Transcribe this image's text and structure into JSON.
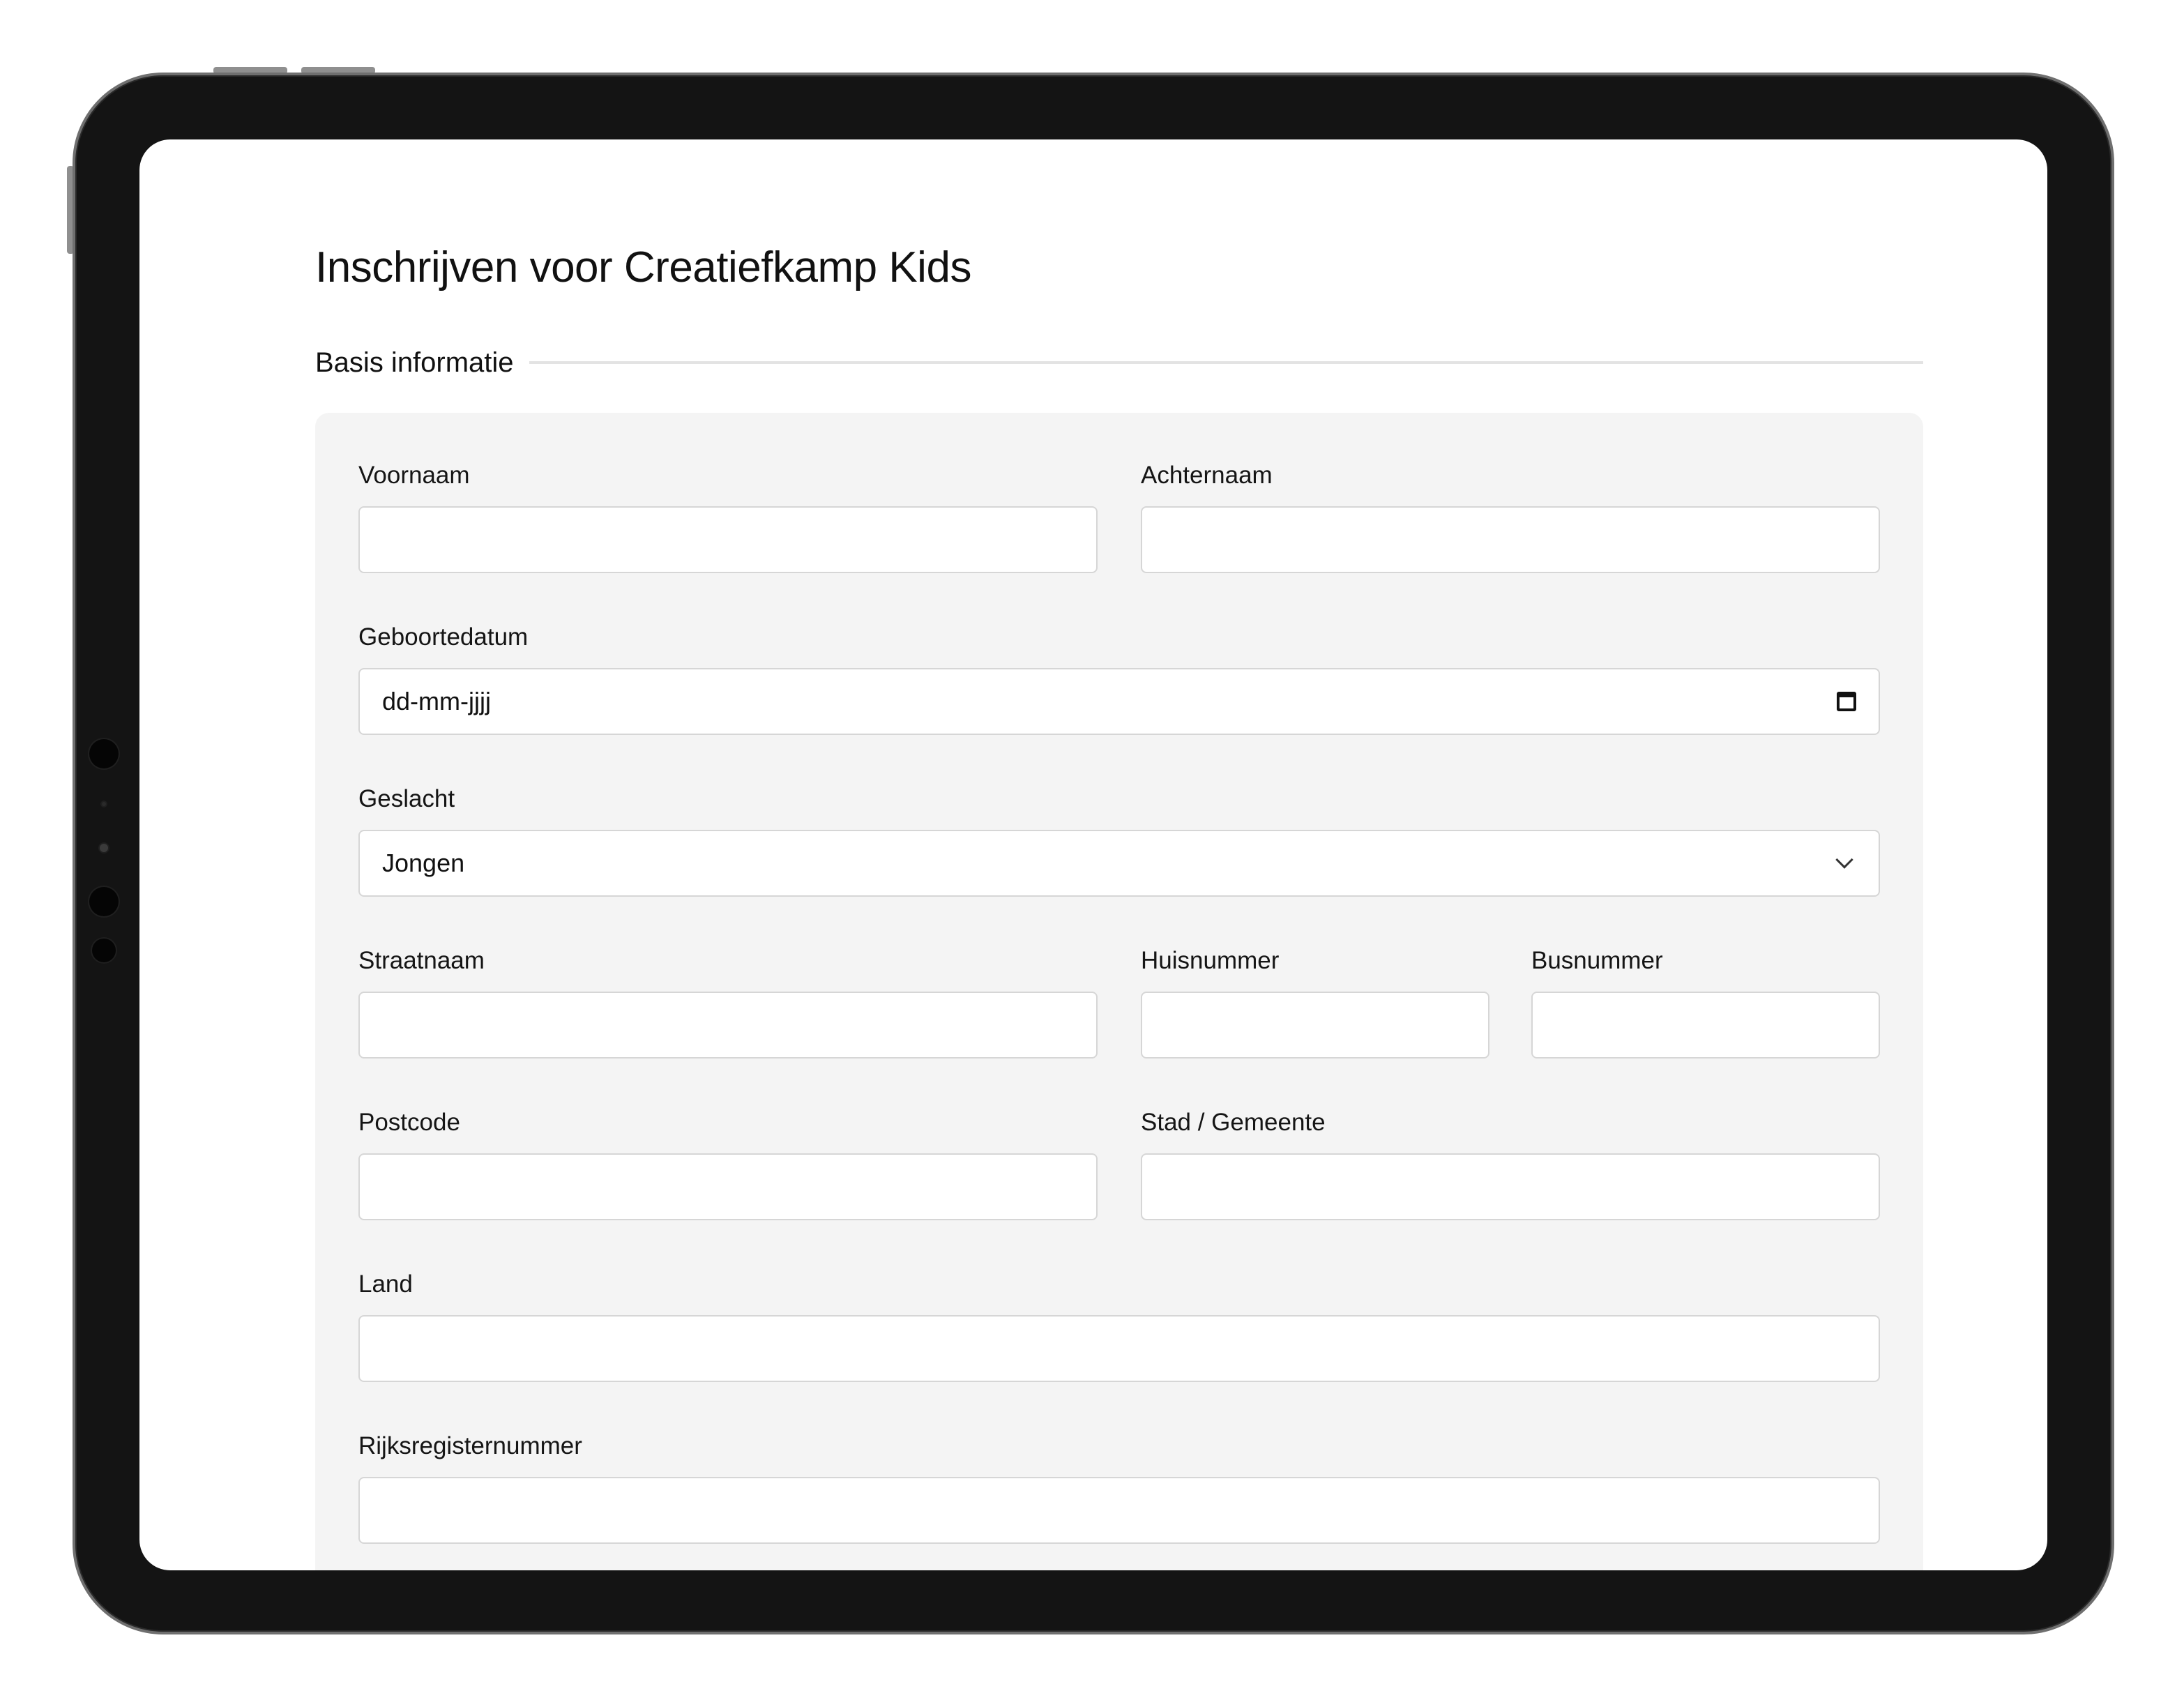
{
  "page": {
    "title": "Inschrijven voor Creatiefkamp Kids"
  },
  "section": {
    "title": "Basis informatie"
  },
  "form": {
    "voornaam": {
      "label": "Voornaam",
      "value": ""
    },
    "achternaam": {
      "label": "Achternaam",
      "value": ""
    },
    "geboortedatum": {
      "label": "Geboortedatum",
      "placeholder": "dd-mm-jjjj",
      "icon": "calendar-icon"
    },
    "geslacht": {
      "label": "Geslacht",
      "selected": "Jongen",
      "icon": "chevron-down-icon"
    },
    "straatnaam": {
      "label": "Straatnaam",
      "value": ""
    },
    "huisnummer": {
      "label": "Huisnummer",
      "value": ""
    },
    "busnummer": {
      "label": "Busnummer",
      "value": ""
    },
    "postcode": {
      "label": "Postcode",
      "value": ""
    },
    "stad": {
      "label": "Stad / Gemeente",
      "value": ""
    },
    "land": {
      "label": "Land",
      "value": ""
    },
    "rijksregisternummer": {
      "label": "Rijksregisternummer",
      "value": ""
    }
  },
  "colors": {
    "device_frame": "#141414",
    "card_background": "#f4f4f4",
    "input_border": "#d6d6d6",
    "text": "#111111"
  }
}
